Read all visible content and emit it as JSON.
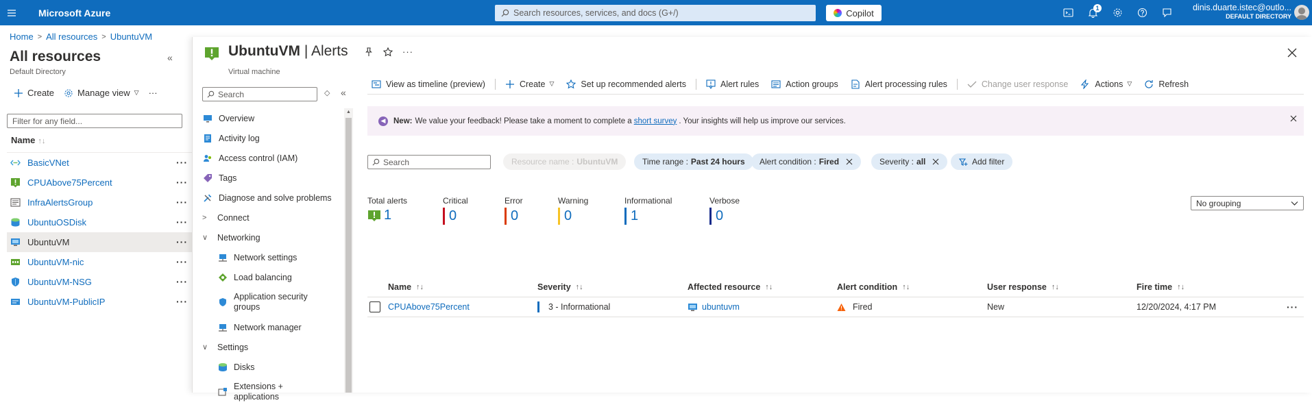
{
  "topbar": {
    "brand": "Microsoft Azure",
    "search_placeholder": "Search resources, services, and docs (G+/)",
    "copilot_label": "Copilot",
    "notification_count": "1",
    "account_user": "dinis.duarte.istec@outlo...",
    "account_directory": "DEFAULT DIRECTORY"
  },
  "breadcrumb": [
    "Home",
    "All resources",
    "UbuntuVM"
  ],
  "left_panel": {
    "title": "All resources",
    "subtitle": "Default Directory",
    "create_label": "Create",
    "manage_view_label": "Manage view",
    "more_label": "···",
    "filter_placeholder": "Filter for any field...",
    "column_name": "Name",
    "resources": [
      {
        "name": "BasicVNet",
        "icon": "vnet-icon"
      },
      {
        "name": "CPUAbove75Percent",
        "icon": "alert-rule-icon"
      },
      {
        "name": "InfraAlertsGroup",
        "icon": "action-group-icon"
      },
      {
        "name": "UbuntuOSDisk",
        "icon": "disk-icon"
      },
      {
        "name": "UbuntuVM",
        "icon": "vm-icon"
      },
      {
        "name": "UbuntuVM-nic",
        "icon": "nic-icon"
      },
      {
        "name": "UbuntuVM-NSG",
        "icon": "nsg-icon"
      },
      {
        "name": "UbuntuVM-PublicIP",
        "icon": "public-ip-icon"
      }
    ]
  },
  "blade": {
    "resource_name": "UbuntuVM",
    "page_name": "Alerts",
    "separator": " | ",
    "resource_type": "Virtual machine"
  },
  "resource_menu": {
    "search_placeholder": "Search",
    "items": [
      {
        "label": "Overview",
        "icon": "monitor-icon",
        "kind": "item"
      },
      {
        "label": "Activity log",
        "icon": "activity-log-icon",
        "kind": "item"
      },
      {
        "label": "Access control (IAM)",
        "icon": "iam-icon",
        "kind": "item"
      },
      {
        "label": "Tags",
        "icon": "tag-icon",
        "kind": "item"
      },
      {
        "label": "Diagnose and solve problems",
        "icon": "wrench-icon",
        "kind": "item"
      },
      {
        "label": "Connect",
        "kind": "group-collapsed"
      },
      {
        "label": "Networking",
        "kind": "group-expanded"
      },
      {
        "label": "Network settings",
        "icon": "network-settings-icon",
        "kind": "sub"
      },
      {
        "label": "Load balancing",
        "icon": "load-balancer-icon",
        "kind": "sub"
      },
      {
        "label": "Application security groups",
        "icon": "asg-icon",
        "kind": "sub-tall"
      },
      {
        "label": "Network manager",
        "icon": "network-manager-icon",
        "kind": "sub"
      },
      {
        "label": "Settings",
        "kind": "group-expanded"
      },
      {
        "label": "Disks",
        "icon": "disk-icon",
        "kind": "sub"
      },
      {
        "label": "Extensions + applications",
        "icon": "extensions-icon",
        "kind": "sub-tall"
      }
    ]
  },
  "commandbar": {
    "timeline": "View as timeline (preview)",
    "create": "Create",
    "recommended": "Set up recommended alerts",
    "alert_rules": "Alert rules",
    "action_groups": "Action groups",
    "processing_rules": "Alert processing rules",
    "change_response": "Change user response",
    "actions": "Actions",
    "refresh": "Refresh"
  },
  "banner": {
    "new_label": "New:",
    "text_before": "We value your feedback! Please take a moment to complete a",
    "link": "short survey",
    "text_after": ". Your insights will help us improve our services."
  },
  "filters": {
    "search_placeholder": "Search",
    "resource_name_label": "Resource name :",
    "resource_name_value": "UbuntuVM",
    "time_range_label": "Time range :",
    "time_range_value": "Past 24 hours",
    "alert_condition_label": "Alert condition :",
    "alert_condition_value": "Fired",
    "severity_label": "Severity :",
    "severity_value": "all",
    "add_filter": "Add filter"
  },
  "summary": {
    "total_label": "Total alerts",
    "total": "1",
    "critical_label": "Critical",
    "critical": "0",
    "error_label": "Error",
    "error": "0",
    "warning_label": "Warning",
    "warning": "0",
    "informational_label": "Informational",
    "informational": "1",
    "verbose_label": "Verbose",
    "verbose": "0",
    "colors": {
      "critical": "#c50f1f",
      "error": "#da3b01",
      "warning": "#f7c325",
      "informational": "#0f6cbd",
      "verbose": "#142a8a"
    }
  },
  "grouping": "No grouping",
  "grid": {
    "columns": [
      "Name",
      "Severity",
      "Affected resource",
      "Alert condition",
      "User response",
      "Fire time"
    ],
    "rows": [
      {
        "name": "CPUAbove75Percent",
        "severity": "3 - Informational",
        "resource": "ubuntuvm",
        "condition": "Fired",
        "response": "New",
        "fire_time": "12/20/2024, 4:17 PM"
      }
    ]
  }
}
